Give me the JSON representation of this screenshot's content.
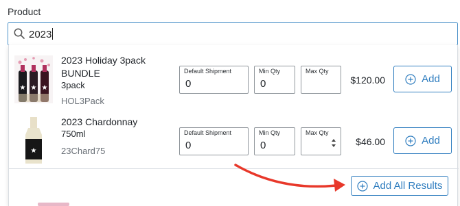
{
  "field": {
    "label": "Product"
  },
  "search": {
    "value": "2023",
    "icon": "search-icon"
  },
  "products": [
    {
      "name": "2023 Holiday 3pack BUNDLE",
      "variant": "3pack",
      "sku": "HOL3Pack",
      "shipment_label": "Default Shipment",
      "shipment_value": "0",
      "min_label": "Min Qty",
      "min_value": "0",
      "max_label": "Max Qty",
      "max_value": "",
      "price": "$120.00",
      "add_label": "Add"
    },
    {
      "name": "2023 Chardonnay",
      "variant": "750ml",
      "sku": "23Chard75",
      "shipment_label": "Default Shipment",
      "shipment_value": "0",
      "min_label": "Min Qty",
      "min_value": "0",
      "max_label": "Max Qty",
      "max_value": "",
      "price": "$46.00",
      "add_label": "Add"
    }
  ],
  "add_all": {
    "label": "Add All Results"
  },
  "colors": {
    "accent": "#2f7dbf",
    "focus_border": "#4a90c8",
    "annotation_arrow": "#e8382a"
  }
}
